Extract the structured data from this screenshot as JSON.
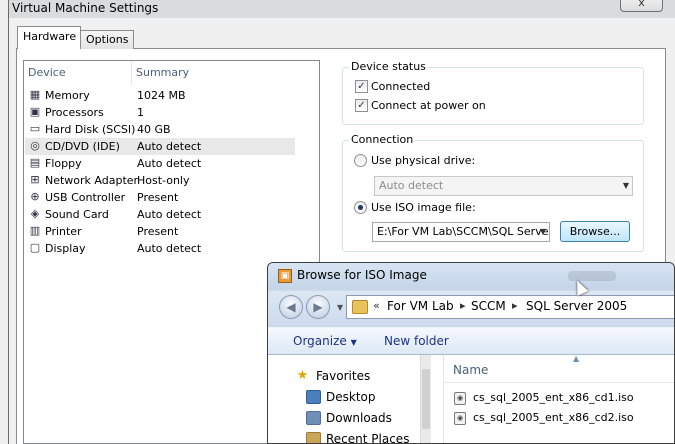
{
  "window": {
    "title": "Virtual Machine Settings",
    "close_glyph": "x",
    "tabs": [
      {
        "label": "Hardware",
        "selected": true
      },
      {
        "label": "Options",
        "selected": false
      }
    ]
  },
  "device_list": {
    "columns": [
      "Device",
      "Summary"
    ],
    "rows": [
      {
        "icon": "memory-icon",
        "device": "Memory",
        "summary": "1024 MB"
      },
      {
        "icon": "processor-icon",
        "device": "Processors",
        "summary": "1"
      },
      {
        "icon": "hard-disk-icon",
        "device": "Hard Disk (SCSI)",
        "summary": "40 GB"
      },
      {
        "icon": "cd-dvd-icon",
        "device": "CD/DVD (IDE)",
        "summary": "Auto detect",
        "selected": true
      },
      {
        "icon": "floppy-icon",
        "device": "Floppy",
        "summary": "Auto detect"
      },
      {
        "icon": "network-adapter-icon",
        "device": "Network Adapter",
        "summary": "Host-only"
      },
      {
        "icon": "usb-controller-icon",
        "device": "USB Controller",
        "summary": "Present"
      },
      {
        "icon": "sound-card-icon",
        "device": "Sound Card",
        "summary": "Auto detect"
      },
      {
        "icon": "printer-icon",
        "device": "Printer",
        "summary": "Present"
      },
      {
        "icon": "display-icon",
        "device": "Display",
        "summary": "Auto detect"
      }
    ]
  },
  "device_status": {
    "title": "Device status",
    "connected_label": "Connected",
    "connected": true,
    "power_on_label": "Connect at power on",
    "power_on": true
  },
  "connection": {
    "title": "Connection",
    "physical_label": "Use physical drive:",
    "physical_value": "Auto detect",
    "iso_label": "Use ISO image file:",
    "iso_value": "E:\\For VM Lab\\SCCM\\SQL Server",
    "selected": "iso",
    "browse_label": "Browse..."
  },
  "browse_dialog": {
    "title": "Browse for ISO Image",
    "back_glyph": "◀",
    "forward_glyph": "▶",
    "breadcrumb": [
      "For VM Lab",
      "SCCM",
      "SQL Server 2005"
    ],
    "breadcrumb_prefix": "«",
    "toolbar": {
      "organize_label": "Organize",
      "new_folder_label": "New folder"
    },
    "nav": {
      "favorites_label": "Favorites",
      "items": [
        {
          "icon": "desktop-icon",
          "label": "Desktop"
        },
        {
          "icon": "downloads-icon",
          "label": "Downloads"
        },
        {
          "icon": "recent-places-icon",
          "label": "Recent Places"
        }
      ]
    },
    "list": {
      "column_name": "Name",
      "files": [
        {
          "icon": "iso-file-icon",
          "name": "cs_sql_2005_ent_x86_cd1.iso"
        },
        {
          "icon": "iso-file-icon",
          "name": "cs_sql_2005_ent_x86_cd2.iso"
        }
      ]
    }
  }
}
